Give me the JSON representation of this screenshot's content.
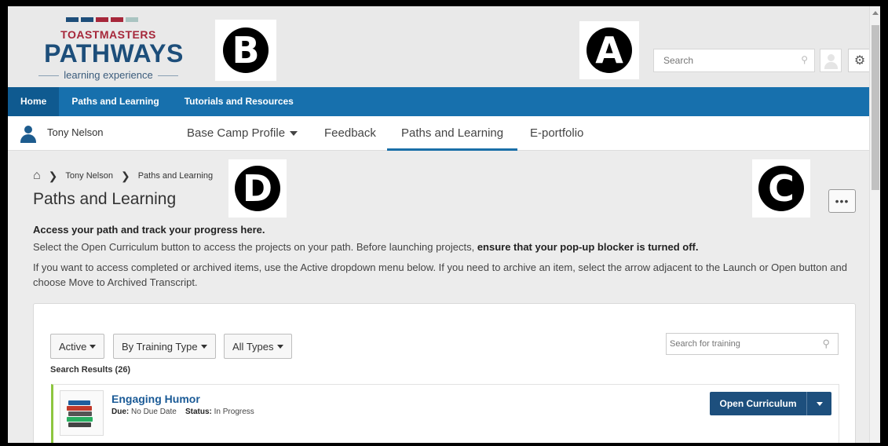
{
  "logo": {
    "line1": "TOASTMASTERS",
    "line2": "PATHWAYS",
    "line3": "learning experience",
    "stripe_colors": [
      "#1d4e7a",
      "#1d4e7a",
      "#a6273a",
      "#a6273a",
      "#a9c4c1"
    ]
  },
  "markers": {
    "a": "A",
    "b": "B",
    "c": "C",
    "d": "D"
  },
  "header": {
    "search_placeholder": "Search",
    "search_icon": "search-icon",
    "settings_icon": "gear-icon"
  },
  "main_nav": {
    "items": [
      "Home",
      "Paths and Learning",
      "Tutorials and Resources"
    ],
    "active": "Home"
  },
  "user_nav": {
    "user_name": "Tony Nelson",
    "tabs": [
      "Base Camp Profile",
      "Feedback",
      "Paths and Learning",
      "E-portfolio"
    ],
    "active_tab": "Paths and Learning"
  },
  "breadcrumb": {
    "items": [
      "Tony Nelson",
      "Paths and Learning"
    ]
  },
  "page": {
    "title": "Paths and Learning",
    "more_label": "•••",
    "intro_heading": "Access your path and track your progress here.",
    "intro_line1": "Select the Open Curriculum button to access the projects on your path. Before launching projects, ",
    "intro_line1_bold": "ensure that your pop-up blocker is turned off.",
    "intro_line2": "If you want to access completed or archived items, use the Active dropdown menu below. If you need to archive an item, select the arrow adjacent to the Launch or Open button and choose Move to Archived Transcript."
  },
  "filters": {
    "status": "Active",
    "training_type": "By Training Type",
    "types": "All Types",
    "search_placeholder": "Search for training",
    "results_label": "Search Results (26)"
  },
  "results": [
    {
      "title": "Engaging Humor",
      "due_label": "Due:",
      "due_value": "No Due Date",
      "status_label": "Status:",
      "status_value": "In Progress",
      "action": "Open Curriculum"
    }
  ],
  "colors": {
    "nav_blue": "#1770ad",
    "button_blue": "#1d4f7d",
    "accent_green": "#8dc63f",
    "link_blue": "#1a5a96"
  }
}
